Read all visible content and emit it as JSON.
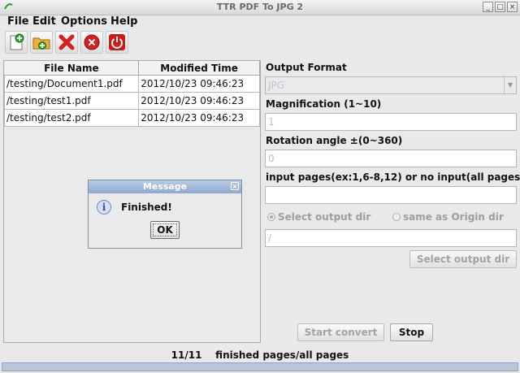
{
  "window": {
    "title": "TTR PDF To JPG 2"
  },
  "menu": [
    "File",
    "Edit",
    "Options",
    "Help"
  ],
  "toolbar": {
    "buttons": [
      "add-file-icon",
      "add-folder-icon",
      "remove-icon",
      "clear-icon",
      "exit-icon"
    ]
  },
  "table": {
    "headers": [
      "File Name",
      "Modified Time"
    ],
    "rows": [
      [
        "/testing/Document1.pdf",
        "2012/10/23 09:46:23"
      ],
      [
        "/testing/test1.pdf",
        "2012/10/23 09:46:23"
      ],
      [
        "/testing/test2.pdf",
        "2012/10/23 09:46:23"
      ]
    ]
  },
  "settings": {
    "output_format_label": "Output Format",
    "output_format_value": "JPG",
    "magnification_label": "Magnification (1~10)",
    "magnification_value": "1",
    "rotation_label": "Rotation angle ±(0~360)",
    "rotation_value": "0",
    "pages_label": "input pages(ex:1,6-8,12) or no input(all pages)",
    "pages_value": "",
    "radio_select_dir": "Select output dir",
    "radio_same_origin": "same as Origin dir",
    "output_dir_value": "/",
    "select_dir_button": "Select output dir"
  },
  "actions": {
    "start_convert": "Start convert",
    "stop": "Stop"
  },
  "status": {
    "count": "11/11",
    "text": "finished pages/all pages"
  },
  "dialog": {
    "title": "Message",
    "message": "Finished!",
    "ok": "OK"
  },
  "colors": {
    "dialog_title": "#9fb5da",
    "progress": "#b8c6d8"
  }
}
